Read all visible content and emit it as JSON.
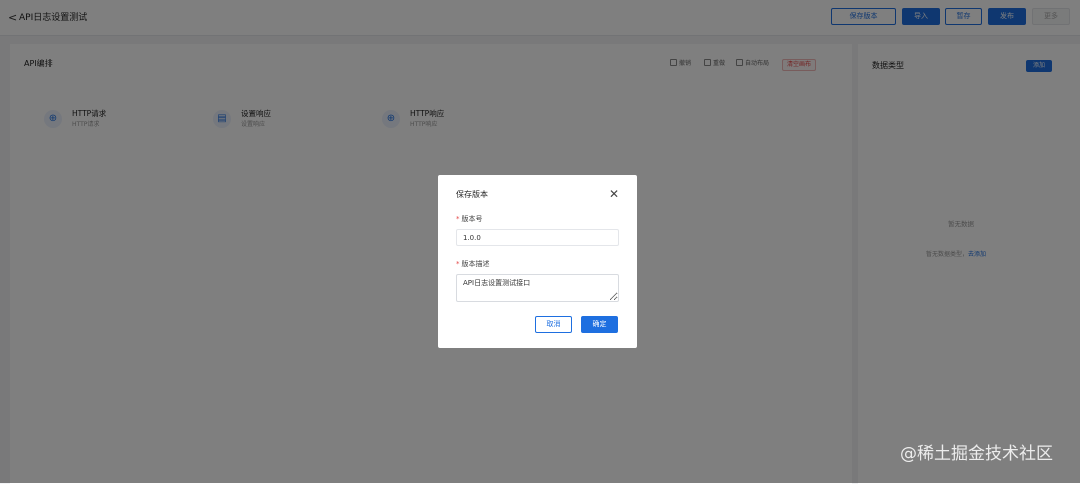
{
  "header": {
    "back_glyph": "<",
    "title": "API日志设置测试",
    "buttons": {
      "save_version": "保存版本",
      "import": "导入",
      "export": "暂存",
      "publish": "发布",
      "disabled": "更多"
    }
  },
  "canvas": {
    "title": "API编排",
    "tools": {
      "t1": "撤销",
      "t2": "重做",
      "t3": "自动布局",
      "danger": "清空画布"
    },
    "nodes": [
      {
        "title": "HTTP请求",
        "subtitle": "HTTP请求",
        "icon": "globe-icon"
      },
      {
        "title": "设置响应",
        "subtitle": "设置响应",
        "icon": "document-icon"
      },
      {
        "title": "HTTP响应",
        "subtitle": "HTTP响应",
        "icon": "globe-icon"
      }
    ]
  },
  "panel": {
    "title": "数据类型",
    "add": "添加",
    "empty": "暂无数据",
    "tip": "暂无数据类型，",
    "tip_link": "去添加"
  },
  "modal": {
    "title": "保存版本",
    "version_label": "版本号",
    "version_value": "1.0.0",
    "desc_label": "版本描述",
    "desc_value": "API日志设置测试接口",
    "cancel": "取消",
    "ok": "确定",
    "required_mark": "*"
  },
  "watermark": "@稀土掘金技术社区",
  "colors": {
    "primary": "#1e6fe0",
    "danger": "#e54545",
    "mask": "rgba(0,0,0,0.5)"
  }
}
